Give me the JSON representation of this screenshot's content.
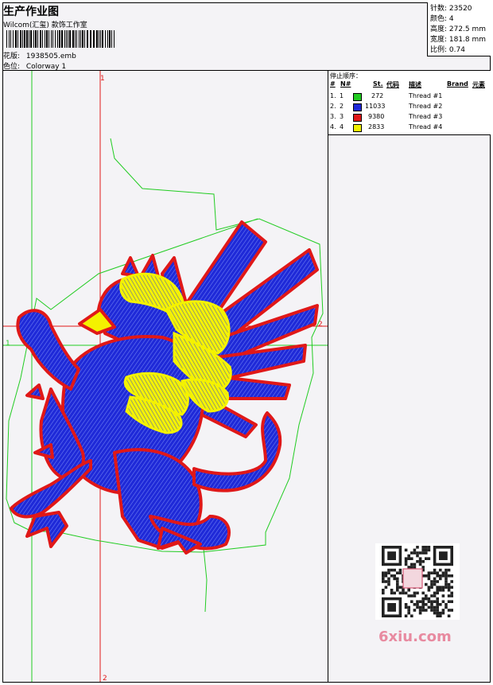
{
  "header": {
    "title": "生产作业图",
    "company": "Wilcom(汇玺) 款饰工作室",
    "design_label": "花版:",
    "design_value": "1938505.emb",
    "colorway_label": "色位:",
    "colorway_value": "Colorway 1"
  },
  "stats": {
    "stitches": "针数: 23520",
    "colors": "颜色: 4",
    "height": "高度: 272.5 mm",
    "width": "宽度: 181.8 mm",
    "scale": "比例: 0.74"
  },
  "thread_table": {
    "title": "停止顺序：",
    "headers": {
      "hash": "#",
      "no": "N#",
      "st": "St.",
      "code": "代码",
      "desc": "描述",
      "brand": "Brand",
      "element": "元素"
    },
    "rows": [
      {
        "idx": "1.",
        "no": "1",
        "code": "272",
        "desc": "Thread #1",
        "color": "#22cc22"
      },
      {
        "idx": "2.",
        "no": "2",
        "code": "11033",
        "desc": "Thread #2",
        "color": "#1f28d8"
      },
      {
        "idx": "3.",
        "no": "3",
        "code": "9380",
        "desc": "Thread #3",
        "color": "#e01818"
      },
      {
        "idx": "4.",
        "no": "4",
        "code": "2833",
        "desc": "Thread #4",
        "color": "#f2f200"
      }
    ]
  },
  "guides": {
    "red_v_top": "1",
    "red_h_right": "2",
    "red_v_bottom": "2",
    "green_h_left": "1"
  },
  "watermark": "6xiu.com"
}
